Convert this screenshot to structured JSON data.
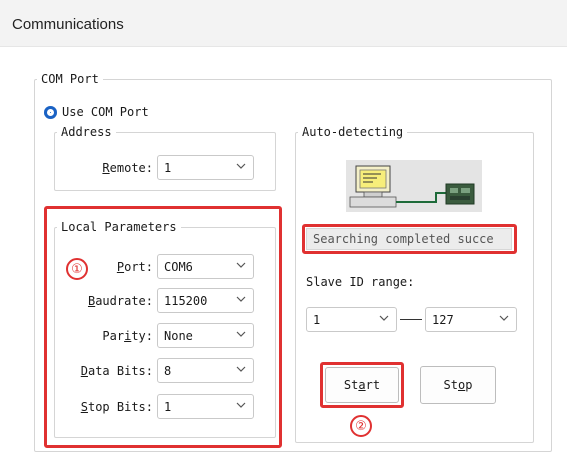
{
  "window": {
    "title": "Communications"
  },
  "com_port": {
    "legend": "COM Port",
    "use_com_port_label": "Use COM Port",
    "address": {
      "legend": "Address",
      "remote": {
        "label_pre": "",
        "label_u": "R",
        "label_post": "emote:",
        "value": "1"
      }
    },
    "local": {
      "legend": "Local Parameters",
      "port": {
        "label_pre": "",
        "label_u": "P",
        "label_post": "ort:",
        "value": "COM6"
      },
      "baudrate": {
        "label_pre": "",
        "label_u": "B",
        "label_post": "audrate:",
        "value": "115200"
      },
      "parity": {
        "label_pre": "Par",
        "label_u": "i",
        "label_post": "ty:",
        "value": "None"
      },
      "data_bits": {
        "label_pre": "",
        "label_u": "D",
        "label_post": "ata Bits:",
        "value": "8"
      },
      "stop_bits": {
        "label_pre": "",
        "label_u": "S",
        "label_post": "top Bits:",
        "value": "1"
      }
    },
    "auto": {
      "legend": "Auto-detecting",
      "status": "Searching completed succe",
      "slave_range_label": "Slave ID range:",
      "range_min": "1",
      "range_max": "127",
      "start": {
        "pre": "St",
        "u": "a",
        "post": "rt"
      },
      "stop": {
        "pre": "St",
        "u": "o",
        "post": "p"
      }
    }
  },
  "annotations": {
    "callout_1": "①",
    "callout_2": "②"
  },
  "icons": {
    "select_chevron": "chevron-down-icon",
    "device": "pc-to-device-icon"
  },
  "colors": {
    "radio_accent": "#1a62c4",
    "highlight": "#e03131"
  }
}
